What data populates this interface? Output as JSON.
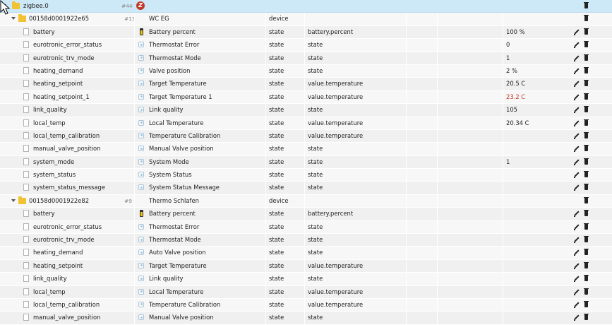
{
  "root": {
    "name": "zigbee.0",
    "count": "#44",
    "logo_letter": "Z"
  },
  "devices": [
    {
      "id": "00158d0001922e65",
      "count": "#13",
      "label": "WC EG",
      "type": "device",
      "states": [
        {
          "name": "battery",
          "icon": "battery-icon",
          "label": "Battery percent",
          "type": "state",
          "role": "battery.percent",
          "value": "100 %",
          "value_color": ""
        },
        {
          "name": "eurotronic_error_status",
          "icon": "state-icon",
          "label": "Thermostat Error",
          "type": "state",
          "role": "state",
          "value": "0",
          "value_color": ""
        },
        {
          "name": "eurotronic_trv_mode",
          "icon": "state-icon",
          "label": "Thermostat Mode",
          "type": "state",
          "role": "state",
          "value": "1",
          "value_color": ""
        },
        {
          "name": "heating_demand",
          "icon": "state-icon",
          "label": "Valve position",
          "type": "state",
          "role": "state",
          "value": "2 %",
          "value_color": ""
        },
        {
          "name": "heating_setpoint",
          "icon": "state-icon",
          "label": "Target Temperature",
          "type": "state",
          "role": "value.temperature",
          "value": "20.5 C",
          "value_color": ""
        },
        {
          "name": "heating_setpoint_1",
          "icon": "state-icon",
          "label": "Target Temperature 1",
          "type": "state",
          "role": "value.temperature",
          "value": "23.2 C",
          "value_color": "#c0392b"
        },
        {
          "name": "link_quality",
          "icon": "state-icon",
          "label": "Link quality",
          "type": "state",
          "role": "state",
          "value": "105",
          "value_color": ""
        },
        {
          "name": "local_temp",
          "icon": "state-icon",
          "label": "Local Temperature",
          "type": "state",
          "role": "value.temperature",
          "value": "20.34 C",
          "value_color": ""
        },
        {
          "name": "local_temp_calibration",
          "icon": "state-icon",
          "label": "Temperature Calibration",
          "type": "state",
          "role": "value.temperature",
          "value": "",
          "value_color": ""
        },
        {
          "name": "manual_valve_position",
          "icon": "state-icon",
          "label": "Manual Valve position",
          "type": "state",
          "role": "state",
          "value": "",
          "value_color": ""
        },
        {
          "name": "system_mode",
          "icon": "state-icon",
          "label": "System Mode",
          "type": "state",
          "role": "state",
          "value": "1",
          "value_color": ""
        },
        {
          "name": "system_status",
          "icon": "state-icon",
          "label": "System Status",
          "type": "state",
          "role": "state",
          "value": "",
          "value_color": ""
        },
        {
          "name": "system_status_message",
          "icon": "state-icon",
          "label": "System Status Message",
          "type": "state",
          "role": "state",
          "value": "",
          "value_color": ""
        }
      ]
    },
    {
      "id": "00158d0001922e82",
      "count": "#9",
      "label": "Thermo Schlafen",
      "type": "device",
      "states": [
        {
          "name": "battery",
          "icon": "battery-icon",
          "label": "Battery percent",
          "type": "state",
          "role": "battery.percent",
          "value": "",
          "value_color": ""
        },
        {
          "name": "eurotronic_error_status",
          "icon": "state-icon",
          "label": "Thermostat Error",
          "type": "state",
          "role": "state",
          "value": "",
          "value_color": ""
        },
        {
          "name": "eurotronic_trv_mode",
          "icon": "state-icon",
          "label": "Thermostat Mode",
          "type": "state",
          "role": "state",
          "value": "",
          "value_color": ""
        },
        {
          "name": "heating_demand",
          "icon": "state-icon",
          "label": "Auto Valve position",
          "type": "state",
          "role": "state",
          "value": "",
          "value_color": ""
        },
        {
          "name": "heating_setpoint",
          "icon": "state-icon",
          "label": "Target Temperature",
          "type": "state",
          "role": "value.temperature",
          "value": "",
          "value_color": ""
        },
        {
          "name": "link_quality",
          "icon": "state-icon",
          "label": "Link quality",
          "type": "state",
          "role": "state",
          "value": "",
          "value_color": ""
        },
        {
          "name": "local_temp",
          "icon": "state-icon",
          "label": "Local Temperature",
          "type": "state",
          "role": "value.temperature",
          "value": "",
          "value_color": ""
        },
        {
          "name": "local_temp_calibration",
          "icon": "state-icon",
          "label": "Temperature Calibration",
          "type": "state",
          "role": "value.temperature",
          "value": "",
          "value_color": ""
        },
        {
          "name": "manual_valve_position",
          "icon": "state-icon",
          "label": "Manual Valve position",
          "type": "state",
          "role": "state",
          "value": "",
          "value_color": ""
        }
      ]
    }
  ]
}
